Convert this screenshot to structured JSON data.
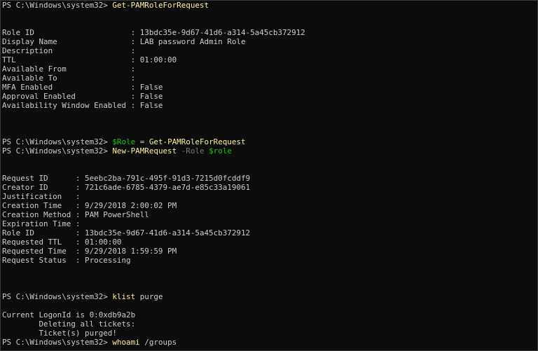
{
  "prompt": "PS C:\\Windows\\system32> ",
  "colors": {
    "background": "#0c0c0c",
    "text": "#cccccc",
    "command": "#f9f1a5",
    "parameter": "#767676",
    "variable": "#16c60c"
  },
  "lines": [
    {
      "type": "prompt",
      "tokens": [
        {
          "k": "cmd",
          "t": "Get-PAMRoleForRequest"
        }
      ]
    },
    {
      "type": "blank"
    },
    {
      "type": "blank"
    },
    {
      "type": "text",
      "text": "Role ID                     : 13bdc35e-9d67-41d6-a314-5a45cb372912"
    },
    {
      "type": "text",
      "text": "Display Name                : LAB password Admin Role"
    },
    {
      "type": "text",
      "text": "Description                 :"
    },
    {
      "type": "text",
      "text": "TTL                         : 01:00:00"
    },
    {
      "type": "text",
      "text": "Available From              :"
    },
    {
      "type": "text",
      "text": "Available To                :"
    },
    {
      "type": "text",
      "text": "MFA Enabled                 : False"
    },
    {
      "type": "text",
      "text": "Approval Enabled            : False"
    },
    {
      "type": "text",
      "text": "Availability Window Enabled : False"
    },
    {
      "type": "blank"
    },
    {
      "type": "blank"
    },
    {
      "type": "blank"
    },
    {
      "type": "prompt",
      "tokens": [
        {
          "k": "var",
          "t": "$Role"
        },
        {
          "k": "op",
          "t": " = "
        },
        {
          "k": "cmd",
          "t": "Get-PAMRoleForRequest"
        }
      ]
    },
    {
      "type": "prompt",
      "tokens": [
        {
          "k": "cmd",
          "t": "New-PAMRequest"
        },
        {
          "k": "op",
          "t": " "
        },
        {
          "k": "param",
          "t": "-Role"
        },
        {
          "k": "op",
          "t": " "
        },
        {
          "k": "var",
          "t": "$role"
        }
      ]
    },
    {
      "type": "blank"
    },
    {
      "type": "blank"
    },
    {
      "type": "text",
      "text": "Request ID      : 5eebc2ba-791c-495f-91d3-7215d0fcddf9"
    },
    {
      "type": "text",
      "text": "Creator ID      : 721c6ade-6785-4379-ae7d-e85c33a19061"
    },
    {
      "type": "text",
      "text": "Justification   :"
    },
    {
      "type": "text",
      "text": "Creation Time   : 9/29/2018 2:00:02 PM"
    },
    {
      "type": "text",
      "text": "Creation Method : PAM PowerShell"
    },
    {
      "type": "text",
      "text": "Expiration Time :"
    },
    {
      "type": "text",
      "text": "Role ID         : 13bdc35e-9d67-41d6-a314-5a45cb372912"
    },
    {
      "type": "text",
      "text": "Requested TTL   : 01:00:00"
    },
    {
      "type": "text",
      "text": "Requested Time  : 9/29/2018 1:59:59 PM"
    },
    {
      "type": "text",
      "text": "Request Status  : Processing"
    },
    {
      "type": "blank"
    },
    {
      "type": "blank"
    },
    {
      "type": "blank"
    },
    {
      "type": "prompt",
      "tokens": [
        {
          "k": "cmd",
          "t": "klist"
        },
        {
          "k": "op",
          "t": " "
        },
        {
          "k": "arg",
          "t": "purge"
        }
      ]
    },
    {
      "type": "blank"
    },
    {
      "type": "text",
      "text": "Current LogonId is 0:0xdb9a2b"
    },
    {
      "type": "text",
      "text": "        Deleting all tickets:"
    },
    {
      "type": "text",
      "text": "        Ticket(s) purged!"
    },
    {
      "type": "prompt",
      "tokens": [
        {
          "k": "cmd",
          "t": "whoami"
        },
        {
          "k": "op",
          "t": " "
        },
        {
          "k": "arg",
          "t": "/groups"
        }
      ]
    }
  ]
}
